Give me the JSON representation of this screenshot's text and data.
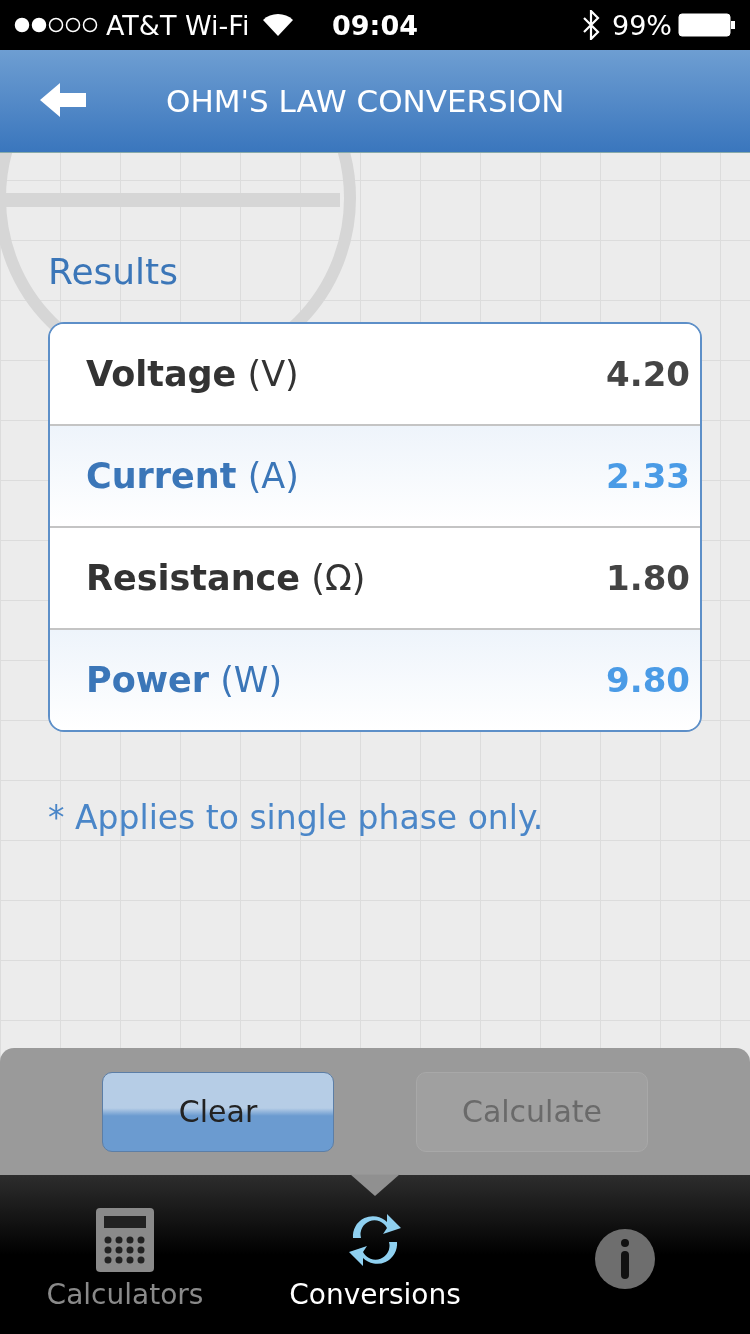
{
  "status_bar": {
    "carrier": "AT&T Wi-Fi",
    "time": "09:04",
    "battery": "99%"
  },
  "header": {
    "title": "OHM'S LAW CONVERSION"
  },
  "results": {
    "heading": "Results",
    "rows": [
      {
        "label": "Voltage",
        "unit": "(V)",
        "value": "4.20",
        "highlighted": false
      },
      {
        "label": "Current",
        "unit": "(A)",
        "value": "2.33",
        "highlighted": true
      },
      {
        "label": "Resistance",
        "unit": "(Ω)",
        "value": "1.80",
        "highlighted": false
      },
      {
        "label": "Power",
        "unit": "(W)",
        "value": "9.80",
        "highlighted": true
      }
    ]
  },
  "note": "* Applies to single phase only.",
  "buttons": [
    {
      "label": "Clear",
      "disabled": false
    },
    {
      "label": "Calculate",
      "disabled": true
    }
  ],
  "tabs": [
    {
      "kind": "calculator",
      "label": "Calculators",
      "selected": false
    },
    {
      "kind": "conversion",
      "label": "Conversions",
      "selected": true
    },
    {
      "kind": "info",
      "selected": false
    }
  ]
}
